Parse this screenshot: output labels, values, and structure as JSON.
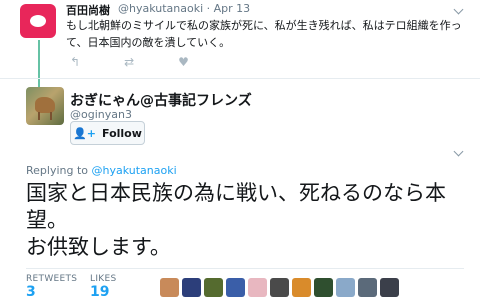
{
  "quoted": {
    "name": "百田尚樹",
    "handle": "@hyakutanaoki · Apr 13",
    "text": "もし北朝鮮のミサイルで私の家族が死に、私が生き残れば、私はテロ組織を作って、日本国内の敵を潰していく。",
    "actions": [
      "reply-icon",
      "retweet-icon",
      "like-icon"
    ]
  },
  "user": {
    "name": "おぎにゃん@古事記フレンズ",
    "handle": "@oginyan3",
    "follow_label": "Follow"
  },
  "tweet": {
    "replying_prefix": "Replying to ",
    "replying_handle": "@hyakutanaoki",
    "text_line1": "国家と日本民族の為に戦い、死ねるのなら本",
    "text_line2": "望。",
    "text_line3": "お供致します。"
  },
  "stats": {
    "retweets_label": "RETWEETS",
    "retweets": "3",
    "likes_label": "LIKES",
    "likes": "19"
  },
  "colors": {
    "accent": "#1da1f2",
    "thread": "#66c2a5",
    "quoted_avatar": "#e8265a"
  },
  "likers": [
    "#c88a5a",
    "#2c3e7a",
    "#556b2f",
    "#3a5ea8",
    "#e8b7c0",
    "#4a4a4a",
    "#d98b2b",
    "#2f4f2f",
    "#8aa9c9",
    "#5b6a7a",
    "#3b3f4a"
  ]
}
